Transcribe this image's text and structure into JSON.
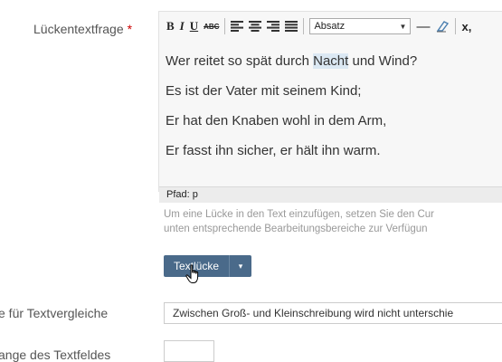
{
  "form": {
    "gap_text_label": "Lückentextfrage",
    "required_marker": "*",
    "text_compare_label": "e für Textvergleiche",
    "field_length_label": "ange des Textfeldes"
  },
  "toolbar": {
    "bold": "B",
    "italic": "I",
    "underline": "U",
    "strikethrough": "ABC",
    "format_value": "Absatz",
    "horizontal_rule": "—",
    "remove_format": "⌀",
    "subscript": "x,"
  },
  "editor": {
    "lines": [
      {
        "before": "Wer reitet so spät durch ",
        "highlight": "Nacht",
        "after": " und Wind?"
      },
      {
        "text": "Es ist der Vater mit seinem Kind;"
      },
      {
        "text": "Er hat den Knaben wohl in dem Arm,"
      },
      {
        "text": "Er fasst ihn sicher, er hält ihn warm."
      }
    ],
    "path": "Pfad: p"
  },
  "hint": {
    "line1": "Um eine Lücke in den Text einzufügen, setzen Sie den Cur",
    "line2": "unten entsprechende Bearbeitungsbereiche zur Verfügun"
  },
  "gap_button": {
    "label": "Textlücke",
    "caret": "▾"
  },
  "text_compare_select": {
    "value": "Zwischen Groß- und Kleinschreibung wird nicht unterschie"
  }
}
